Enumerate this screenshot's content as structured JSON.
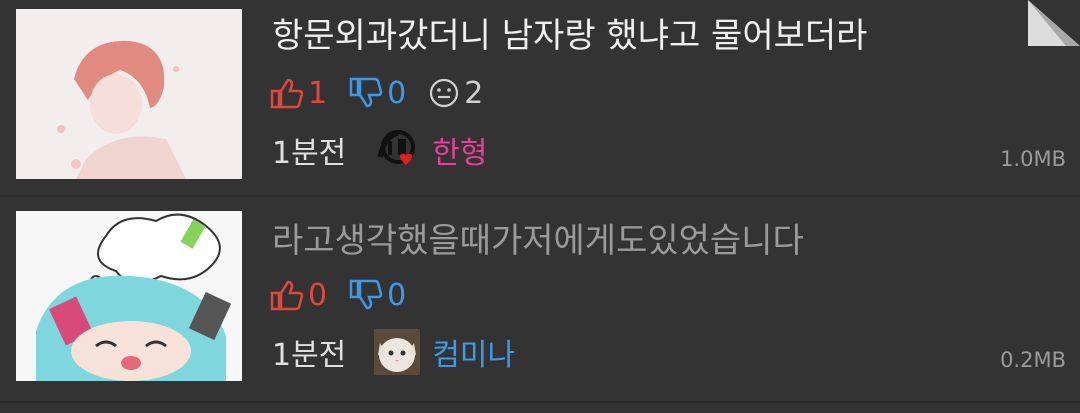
{
  "posts": [
    {
      "title": "항문외과갔더니 남자랑 했냐고 물어보더라",
      "upvotes": "1",
      "downvotes": "0",
      "comments": "2",
      "time": "1분전",
      "nickname": "한형",
      "size": "1.0MB",
      "nick_color": "#ea3f98"
    },
    {
      "title": "라고생각했을때가저에게도있었습니다",
      "upvotes": "0",
      "downvotes": "0",
      "time": "1분전",
      "nickname": "컴미나",
      "size": "0.2MB",
      "nick_color": "#3e9ae8"
    }
  ],
  "icons": {
    "upvote": "thumbs-up-icon",
    "downvote": "thumbs-down-icon",
    "comment": "smiley-icon"
  }
}
